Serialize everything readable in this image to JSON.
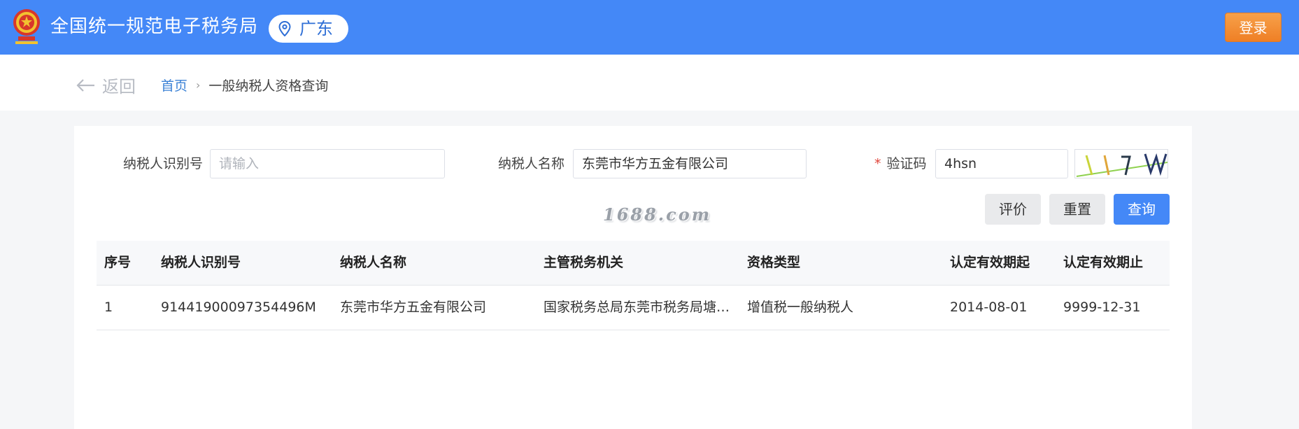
{
  "header": {
    "title": "全国统一规范电子税务局",
    "region": "广东",
    "login_label": "登录"
  },
  "nav": {
    "back_label": "返回",
    "breadcrumb_home": "首页",
    "breadcrumb_sep": "›",
    "breadcrumb_current": "一般纳税人资格查询"
  },
  "form": {
    "taxpayer_id_label": "纳税人识别号",
    "taxpayer_id_placeholder": "请输入",
    "taxpayer_name_label": "纳税人名称",
    "taxpayer_name_value": "东莞市华方五金有限公司",
    "captcha_required_mark": "*",
    "captcha_label": "验证码",
    "captcha_value": "4hsn",
    "buttons": {
      "evaluate": "评价",
      "reset": "重置",
      "query": "查询"
    }
  },
  "watermark": "1688.com",
  "table": {
    "columns": [
      "序号",
      "纳税人识别号",
      "纳税人名称",
      "主管税务机关",
      "资格类型",
      "认定有效期起",
      "认定有效期止"
    ],
    "rows": [
      [
        "1",
        "91441900097354496M",
        "东莞市华方五金有限公司",
        "国家税务总局东莞市税务局塘…",
        "增值税一般纳税人",
        "2014-08-01",
        "9999-12-31"
      ]
    ]
  },
  "colors": {
    "brand_blue": "#4488f7",
    "login_orange": "#f08a2e",
    "link_blue": "#3c82d6",
    "required_red": "#e0443a"
  }
}
